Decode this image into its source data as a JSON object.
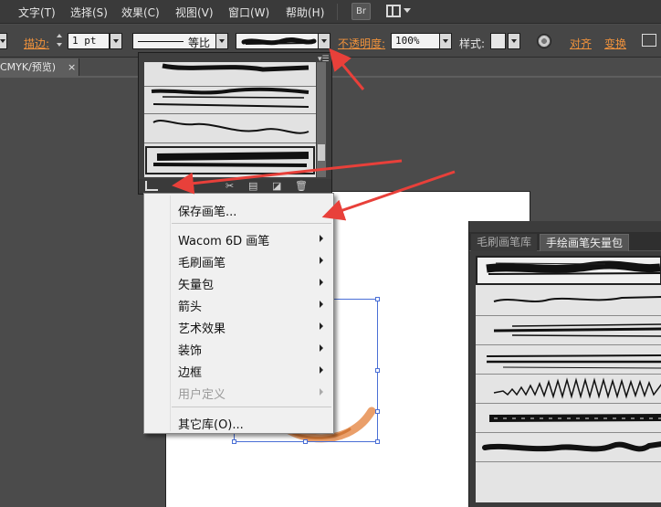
{
  "menubar": {
    "items": [
      "文字(T)",
      "选择(S)",
      "效果(C)",
      "视图(V)",
      "窗口(W)",
      "帮助(H)"
    ],
    "bridge_label": "Br"
  },
  "control_bar": {
    "stroke_label": "描边:",
    "stroke_weight": "1 pt",
    "profile_label": "等比",
    "opacity_label": "不透明度:",
    "opacity_value": "100%",
    "style_label": "样式:",
    "align_label": "对齐",
    "transform_label": "变换"
  },
  "document": {
    "tab_label": "CMYK/预览)",
    "close_glyph": "×"
  },
  "brush_dropdown": {
    "menu_glyph": "▾☰",
    "footer_icons": [
      "✂",
      "▤",
      "◪",
      "🗑"
    ]
  },
  "context_menu": {
    "items": [
      {
        "label": "保存画笔...",
        "submenu": false,
        "disabled": false
      },
      {
        "label": "Wacom 6D 画笔",
        "submenu": true,
        "disabled": false
      },
      {
        "label": "毛刷画笔",
        "submenu": true,
        "disabled": false
      },
      {
        "label": "矢量包",
        "submenu": true,
        "disabled": false
      },
      {
        "label": "箭头",
        "submenu": true,
        "disabled": false
      },
      {
        "label": "艺术效果",
        "submenu": true,
        "disabled": false
      },
      {
        "label": "装饰",
        "submenu": true,
        "disabled": false
      },
      {
        "label": "边框",
        "submenu": true,
        "disabled": false
      },
      {
        "label": "用户定义",
        "submenu": true,
        "disabled": true
      },
      {
        "label": "其它库(O)...",
        "submenu": false,
        "disabled": false
      }
    ]
  },
  "library_panel": {
    "tabs": [
      {
        "label": "毛刷画笔库",
        "active": false
      },
      {
        "label": "手绘画笔矢量包",
        "active": true
      }
    ]
  },
  "colors": {
    "annotation_arrow": "#e8403a",
    "accent_orange": "#f0923c",
    "selection_blue": "#4a6fd6",
    "stroke_orange": "#e8955a"
  }
}
